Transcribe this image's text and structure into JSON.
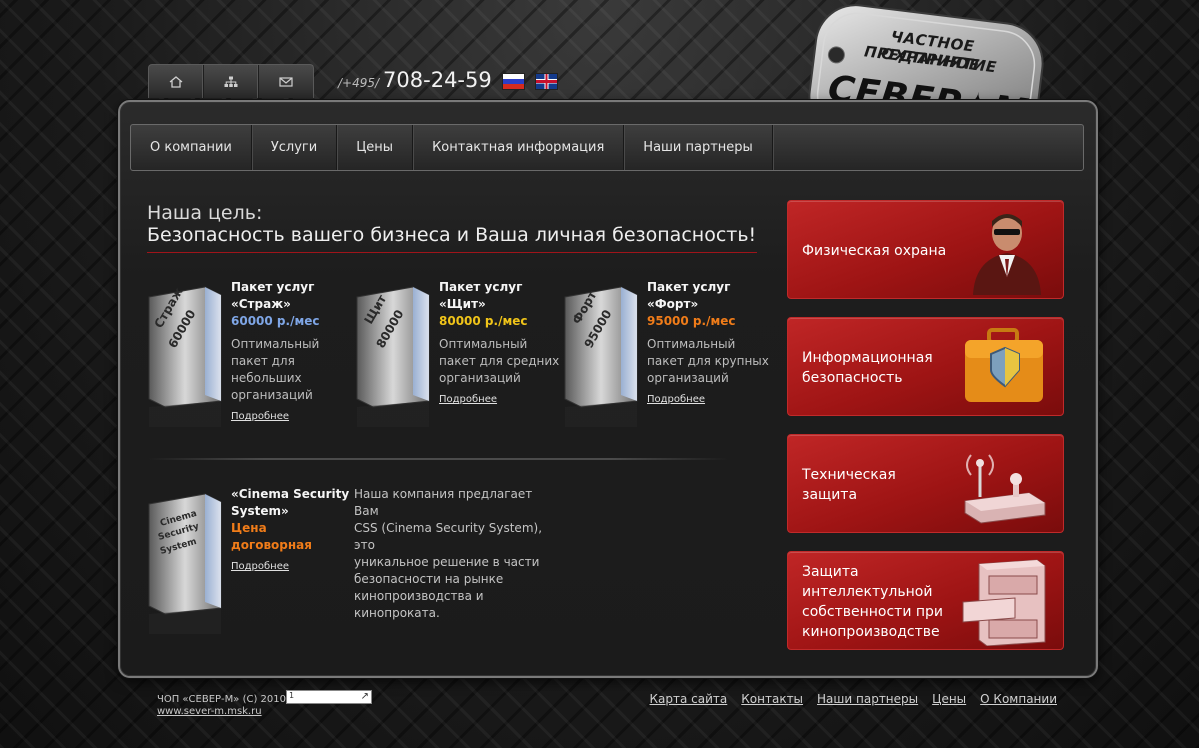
{
  "phone": {
    "code": "/+495/",
    "number": "708-24-59"
  },
  "logo": {
    "line1": "ЧАСТНОЕ ОХРАННОЕ",
    "line2": "ПРЕДПРИЯТИЕ",
    "brand": "СЕВЕР✦М"
  },
  "icon_tabs": [
    "home-icon",
    "sitemap-icon",
    "mail-icon"
  ],
  "nav": [
    "О компании",
    "Услуги",
    "Цены",
    "Контактная информация",
    "Наши партнеры"
  ],
  "goal": {
    "line1": "Наша цель:",
    "line2": "Безопасность вашего бизнеса и Ваша личная безопасность!"
  },
  "packages": [
    {
      "box_l1": "Страж",
      "box_l2": "60000",
      "title1": "Пакет услуг",
      "title2": "«Страж»",
      "price": "60000 р./мес",
      "price_color": "#7fa6e6",
      "desc1": "Оптимальный",
      "desc2": "пакет для",
      "desc3": "небольших",
      "desc4": "организаций",
      "more": "Подробнее"
    },
    {
      "box_l1": "Щит",
      "box_l2": "80000",
      "title1": "Пакет услуг",
      "title2": "«Щит»",
      "price": "80000 р./мес",
      "price_color": "#f0c419",
      "desc1": "Оптимальный",
      "desc2": "пакет для средних",
      "desc3": "организаций",
      "more": "Подробнее"
    },
    {
      "box_l1": "Форт",
      "box_l2": "95000",
      "title1": "Пакет услуг",
      "title2": "«Форт»",
      "price": "95000 р./мес",
      "price_color": "#f07c19",
      "desc1": "Оптимальный",
      "desc2": "пакет для крупных",
      "desc3": "организаций",
      "more": "Подробнее"
    }
  ],
  "cinema": {
    "box_l1": "Cinema",
    "box_l2": "Security",
    "box_l3": "System",
    "title1": "«Cinema Security",
    "title2": "System»",
    "price1": "Цена",
    "price2": "договорная",
    "price_color": "#f07c19",
    "more": "Подробнее",
    "desc": [
      "Наша компания предлагает Вам",
      "CSS (Cinema Security System), это",
      "уникальное решение в части",
      "безопасности на рынке",
      "кинопроизводства и",
      "кинопроката."
    ]
  },
  "services": [
    {
      "l1": "Физическая охрана",
      "icon": "guard-icon"
    },
    {
      "l1": "Информационная",
      "l2": "безопасность",
      "icon": "briefcase-shield-icon"
    },
    {
      "l1": "Техническая",
      "l2": "защита",
      "icon": "device-antenna-icon"
    },
    {
      "l1": "Защита",
      "l2": "интеллектульной",
      "l3": "собственности при",
      "l4": "кинопроизводстве",
      "icon": "file-cabinet-icon"
    }
  ],
  "footer": {
    "copyright": "ЧОП «СЕВЕР-М» (С) 2010",
    "site": "www.sever-m.msk.ru",
    "counter": "1",
    "links": [
      "Карта сайта",
      "Контакты",
      "Наши партнеры",
      "Цены",
      "О Компании"
    ]
  },
  "colors": {
    "accent_red": "#a0141a",
    "card_red": "#b01e1e",
    "background": "#1c1c1c"
  }
}
